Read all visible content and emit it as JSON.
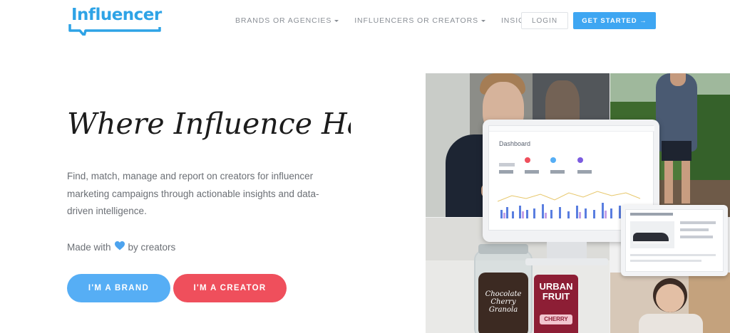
{
  "brand": {
    "name": "Influencer"
  },
  "nav": {
    "items": [
      {
        "label": "BRANDS OR AGENCIES",
        "has_dropdown": true
      },
      {
        "label": "INFLUENCERS OR CREATORS",
        "has_dropdown": true
      },
      {
        "label": "INSIGHTS",
        "has_dropdown": false
      }
    ],
    "login_label": "LOGIN",
    "get_started_label": "GET STARTED →"
  },
  "hero": {
    "title": "Where Influence Happens",
    "description": "Find, match, manage and report on creators for influencer marketing campaigns through actionable insights and data-driven intelligence.",
    "made_with_prefix": "Made with",
    "made_with_suffix": "by creators",
    "brand_button": "I'M A BRAND",
    "creator_button": "I'M A CREATOR"
  },
  "collage": {
    "dashboard_title": "Dashboard",
    "jar_label": "Chocolate Cherry Granola",
    "bag_label_1": "URBAN",
    "bag_label_2": "FRUIT",
    "bag_label_3": "CHERRY"
  },
  "colors": {
    "brand_blue": "#2ea3e6",
    "cta_blue": "#3ea6f2",
    "brand_button": "#56aef5",
    "creator_button": "#ef4f5c",
    "heart": "#4da3ee"
  },
  "icons": [
    "logo-speech-bubble",
    "caret-down-icon",
    "heart-icon"
  ]
}
